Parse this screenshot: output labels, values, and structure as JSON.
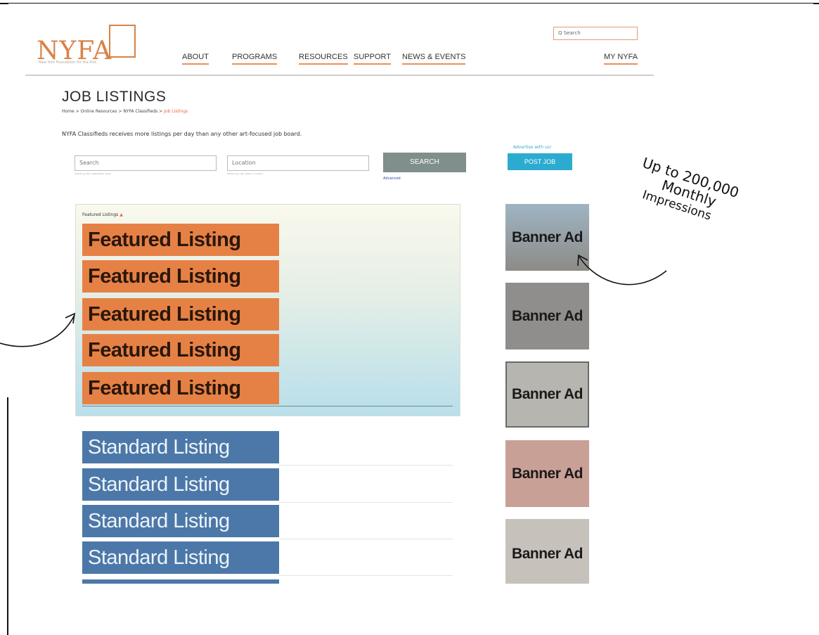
{
  "header": {
    "logo_text": "NYFA",
    "tagline": "New York Foundation for the Arts",
    "nav": [
      "ABOUT",
      "PROGRAMS",
      "RESOURCES",
      "SUPPORT",
      "NEWS & EVENTS"
    ],
    "my_account": "MY NYFA",
    "search_placeholder": "Q  Search"
  },
  "page": {
    "title": "JOB LISTINGS",
    "breadcrumb": [
      "Home",
      "Online Resources",
      "NYFA Classifieds",
      "Job Listings"
    ],
    "intro": "NYFA Classifieds receives more listings per day than any other art-focused job board.",
    "search_field": {
      "placeholder": "Search",
      "hint": "Search by title, organization name"
    },
    "location_field": {
      "placeholder": "Location",
      "hint": "Where (e.g. city, state or country)"
    },
    "search_button": "SEARCH",
    "advanced_link": "Advanced",
    "advertise_text": "Advertise with us!",
    "post_job_button": "POST JOB",
    "featured_label": "Featured Listings",
    "featured_listings": [
      "Featured Listing",
      "Featured Listing",
      "Featured Listing",
      "Featured Listing",
      "Featured Listing"
    ],
    "standard_listings": [
      "Standard Listing",
      "Standard Listing",
      "Standard Listing",
      "Standard Listing"
    ],
    "banner_ads": [
      "Banner Ad",
      "Banner Ad",
      "Banner Ad",
      "Banner Ad",
      "Banner Ad"
    ]
  },
  "annotation": {
    "lines": [
      "Up to 200,000",
      "Monthly",
      "Impressions"
    ]
  },
  "colors": {
    "brand_orange": "#d98246",
    "featured_bg": "#e68146",
    "standard_bg": "#4b78a8",
    "post_job": "#2cabd0",
    "search_button": "#7f8f8b"
  }
}
